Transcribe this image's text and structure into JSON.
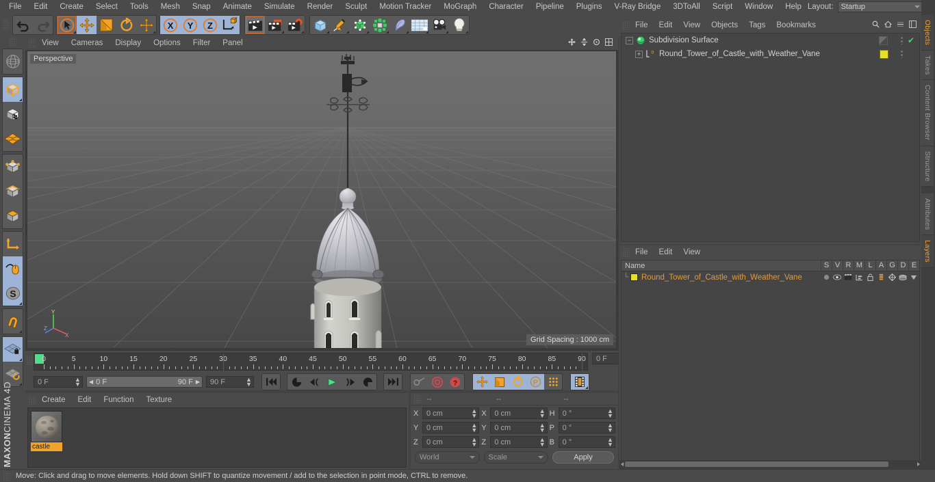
{
  "menubar": {
    "items": [
      "File",
      "Edit",
      "Create",
      "Select",
      "Tools",
      "Mesh",
      "Snap",
      "Animate",
      "Simulate",
      "Render",
      "Sculpt",
      "Motion Tracker",
      "MoGraph",
      "Character",
      "Pipeline",
      "Plugins",
      "V-Ray Bridge",
      "3DToAll",
      "Script",
      "Window",
      "Help"
    ],
    "layout_label": "Layout:",
    "layout_value": "Startup"
  },
  "toolbar": {
    "undo": "undo-arrow",
    "redo": "redo-arrow",
    "tools": [
      "live-selection",
      "move",
      "scale",
      "rotate",
      "move-axis"
    ],
    "axes": [
      "X",
      "Y",
      "Z"
    ],
    "world_object": "world-coordinate-toggle",
    "render_view": "render-view",
    "render_region": "render-region",
    "render_settings": "render-settings",
    "primitives": "cube-primitive",
    "spline": "pen-spline",
    "generator": "subdivision-generator",
    "deformer": "mograph-cloner",
    "bend": "bend-deformer",
    "floor": "floor-environment",
    "camera": "camera-object",
    "light": "light-object"
  },
  "left_toolbar": {
    "items": [
      "world-axis",
      "cube-model-mode",
      "texture-mode",
      "polygon-grid",
      "point-mode",
      "edge-mode",
      "polygon-mode",
      "axis-mode",
      "viewport-solo",
      "enable-snap-s",
      "magnet-tool",
      "workplane-lock",
      "workplane-rotate"
    ],
    "brand_top": "MAXON",
    "brand_bottom": "CINEMA 4D"
  },
  "viewport": {
    "menu": [
      "View",
      "Cameras",
      "Display",
      "Options",
      "Filter",
      "Panel"
    ],
    "view_label": "Perspective",
    "grid_badge": "Grid Spacing : 1000 cm",
    "axis_y": "Y",
    "axis_x": "X",
    "axis_z": "Z"
  },
  "timeline": {
    "ticks": [
      0,
      5,
      10,
      15,
      20,
      25,
      30,
      35,
      40,
      45,
      50,
      55,
      60,
      65,
      70,
      75,
      80,
      85,
      90
    ],
    "current_frame": "0 F",
    "range_start": "0 F",
    "range_end": "90 F",
    "end_frame": "90 F",
    "preview_min": "0 F",
    "preview_max": "90 F",
    "transport": [
      "goto-start",
      "frame-back-key",
      "frame-back",
      "play",
      "frame-forward",
      "play-reverse-loop",
      "goto-end"
    ],
    "record_tools": [
      "autokey",
      "record-active-objects",
      "keyframe-selection"
    ],
    "anim_modes": [
      "position-key",
      "scale-key",
      "rotation-key",
      "parameter-key",
      "point-level-animation",
      "animation-mode"
    ]
  },
  "material_manager": {
    "menu": [
      "Create",
      "Edit",
      "Function",
      "Texture"
    ],
    "materials": [
      {
        "name": "castle"
      }
    ]
  },
  "coordinates": {
    "headers": [
      "--",
      "--",
      "--"
    ],
    "rows": [
      {
        "pos_axis": "X",
        "pos_value": "0 cm",
        "size_axis": "X",
        "size_value": "0 cm",
        "rot_axis": "H",
        "rot_value": "0 °"
      },
      {
        "pos_axis": "Y",
        "pos_value": "0 cm",
        "size_axis": "Y",
        "size_value": "0 cm",
        "rot_axis": "P",
        "rot_value": "0 °"
      },
      {
        "pos_axis": "Z",
        "pos_value": "0 cm",
        "size_axis": "Z",
        "size_value": "0 cm",
        "rot_axis": "B",
        "rot_value": "0 °"
      }
    ],
    "coord_system": "World",
    "transform_mode": "Scale",
    "apply_label": "Apply"
  },
  "object_manager": {
    "menu": [
      "File",
      "Edit",
      "View",
      "Objects",
      "Tags",
      "Bookmarks"
    ],
    "rows": [
      {
        "label": "Subdivision Surface",
        "icon": "subdivision-surface-icon",
        "indent": 0,
        "checked": "✔"
      },
      {
        "label": "Round_Tower_of_Castle_with_Weather_Vane",
        "icon": "polygon-object-icon",
        "indent": 1,
        "tag": "L0"
      }
    ]
  },
  "layer_manager": {
    "menu": [
      "File",
      "Edit",
      "View"
    ],
    "columns": [
      "Name",
      "S",
      "V",
      "R",
      "M",
      "L",
      "A",
      "G",
      "D",
      "E"
    ],
    "rows": [
      {
        "name": "Round_Tower_of_Castle_with_Weather_Vane",
        "color": "#e8e024"
      }
    ]
  },
  "right_tabs": [
    {
      "label": "Objects",
      "active": true
    },
    {
      "label": "Takes",
      "active": false
    },
    {
      "label": "Content Browser",
      "active": false
    },
    {
      "label": "Structure",
      "active": false
    },
    {
      "label": "Attributes",
      "active": false
    },
    {
      "label": "Layers",
      "active": true
    }
  ],
  "status_bar": {
    "message": "Move: Click and drag to move elements. Hold down SHIFT to quantize movement / add to the selection in point mode, CTRL to remove."
  },
  "colors": {
    "accent_orange": "#e8a33d",
    "selection_blue": "#9db4d6",
    "panel_bg": "#4a4a4a",
    "field_bg": "#3f3f3f",
    "layer_yellow": "#e8e024",
    "play_green": "#4fdc8b"
  }
}
